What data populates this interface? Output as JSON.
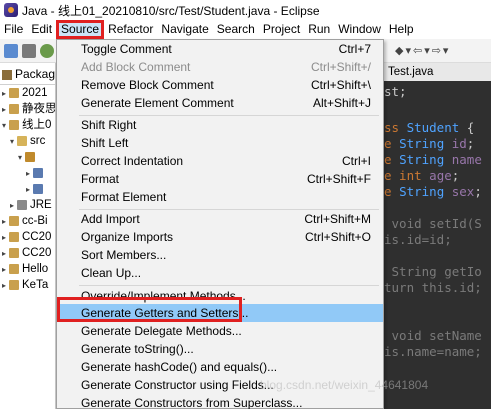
{
  "window": {
    "title": "Java - 线上01_20210810/src/Test/Student.java - Eclipse"
  },
  "menubar": {
    "items": [
      "File",
      "Edit",
      "Source",
      "Refactor",
      "Navigate",
      "Search",
      "Project",
      "Run",
      "Window",
      "Help"
    ]
  },
  "left_panel": {
    "tab_label": "Package",
    "tree": [
      "2021",
      "静夜思",
      "线上0",
      "src",
      "",
      "",
      "",
      "JRE",
      "cc-Bi",
      "CC20",
      "CC20",
      "Hello",
      "KeTa"
    ]
  },
  "editor": {
    "tab_label": "Test.java",
    "lines": [
      "st;",
      "",
      "ss Student {",
      "e String id;",
      "e String name",
      "e int age;",
      "e String sex;",
      "",
      " void setId(S",
      "is.id=id;",
      "",
      " String getIo",
      "turn this.id;",
      "",
      " void setName",
      "is.name=name;"
    ],
    "watermark": "blog.csdn.net/weixin_44641804"
  },
  "source_menu": {
    "items": [
      {
        "label": "Toggle Comment",
        "shortcut": "Ctrl+7",
        "disabled": false
      },
      {
        "label": "Add Block Comment",
        "shortcut": "Ctrl+Shift+/",
        "disabled": true
      },
      {
        "label": "Remove Block Comment",
        "shortcut": "Ctrl+Shift+\\",
        "disabled": false
      },
      {
        "label": "Generate Element Comment",
        "shortcut": "Alt+Shift+J",
        "disabled": false
      },
      {
        "label": "Shift Right",
        "shortcut": "",
        "disabled": false
      },
      {
        "label": "Shift Left",
        "shortcut": "",
        "disabled": false
      },
      {
        "label": "Correct Indentation",
        "shortcut": "Ctrl+I",
        "disabled": false
      },
      {
        "label": "Format",
        "shortcut": "Ctrl+Shift+F",
        "disabled": false
      },
      {
        "label": "Format Element",
        "shortcut": "",
        "disabled": false
      },
      {
        "label": "Add Import",
        "shortcut": "Ctrl+Shift+M",
        "disabled": false
      },
      {
        "label": "Organize Imports",
        "shortcut": "Ctrl+Shift+O",
        "disabled": false
      },
      {
        "label": "Sort Members...",
        "shortcut": "",
        "disabled": false
      },
      {
        "label": "Clean Up...",
        "shortcut": "",
        "disabled": false
      },
      {
        "label": "Override/Implement Methods...",
        "shortcut": "",
        "disabled": false
      },
      {
        "label": "Generate Getters and Setters...",
        "shortcut": "",
        "disabled": false,
        "highlighted": true
      },
      {
        "label": "Generate Delegate Methods...",
        "shortcut": "",
        "disabled": false
      },
      {
        "label": "Generate toString()...",
        "shortcut": "",
        "disabled": false
      },
      {
        "label": "Generate hashCode() and equals()...",
        "shortcut": "",
        "disabled": false
      },
      {
        "label": "Generate Constructor using Fields...",
        "shortcut": "",
        "disabled": false
      },
      {
        "label": "Generate Constructors from Superclass...",
        "shortcut": "",
        "disabled": false
      }
    ]
  },
  "colors": {
    "highlight": "#91c9f7",
    "annotation_red": "#e02020",
    "menu_bg": "#f2f2f2",
    "editor_bg": "#2f2f2f"
  }
}
